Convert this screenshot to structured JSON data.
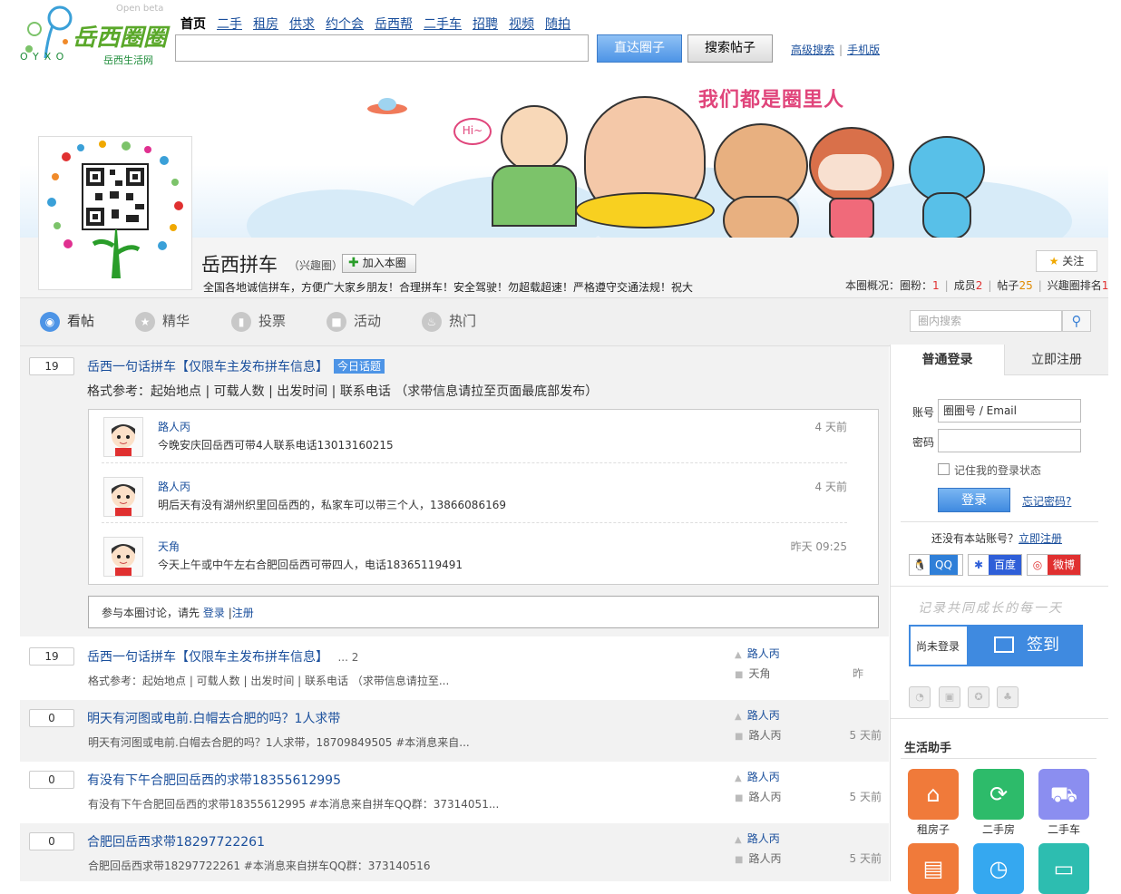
{
  "header": {
    "logo_text": "岳西圈圈",
    "logo_sub": "岳西生活网",
    "logo_letters": "OYXO",
    "beta": "Open beta",
    "nav": [
      "首页",
      "二手",
      "租房",
      "供求",
      "约个会",
      "岳西帮",
      "二手车",
      "招聘",
      "视频",
      "随拍"
    ],
    "search_placeholder": "",
    "btn_circle": "直达圈子",
    "btn_posts": "搜索帖子",
    "link_advanced": "高级搜索",
    "link_mobile": "手机版"
  },
  "banner": {
    "slogan": "我们都是圈里人",
    "hi": "Hi~"
  },
  "circle": {
    "name": "岳西拼车",
    "tag": "（兴趣圈）",
    "join": "加入本圈",
    "description": "全国各地诚信拼车，方便广大家乡朋友！合理拼车！安全驾驶！勿超载超速！严格遵守交通法规！祝大",
    "follow": "关注",
    "overview_label": "本圈概况：",
    "fans_label": "圈粉：",
    "fans": "1",
    "members_label": "成员",
    "members": "2",
    "posts_label": "帖子",
    "posts": "25",
    "rank_label": "兴趣圈排名",
    "rank": "1"
  },
  "tabs": [
    "看帖",
    "精华",
    "投票",
    "活动",
    "热门"
  ],
  "inner_search_placeholder": "圈内搜索",
  "pinned": {
    "count": "19",
    "title": "岳西一句话拼车【仅限车主发布拼车信息】",
    "badge": "今日话题",
    "format": "格式参考：起始地点 | 可载人数 | 出发时间 | 联系电话 （求带信息请拉至页面最底部发布）",
    "replies": [
      {
        "name": "路人丙",
        "text": "今晚安庆回岳西可带4人联系电话13013160215",
        "time": "4 天前"
      },
      {
        "name": "路人丙",
        "text": "明后天有没有湖州织里回岳西的，私家车可以带三个人，13866086169",
        "time": "4 天前"
      },
      {
        "name": "天角",
        "text": "今天上午或中午左右合肥回岳西可带四人，电话18365119491",
        "time": "昨天 09:25"
      }
    ],
    "join_prompt": "参与本圈讨论，请先",
    "login": "登录",
    "sep": "|",
    "register": "注册"
  },
  "topics": [
    {
      "count": "19",
      "title": "岳西一句话拼车【仅限车主发布拼车信息】",
      "pages": "... 2",
      "summary": "格式参考：起始地点 | 可载人数 | 出发时间 | 联系电话 （求带信息请拉至...",
      "author": "路人丙",
      "last": "天角",
      "ago": "昨"
    },
    {
      "count": "0",
      "title": "明天有河图或电前.白帽去合肥的吗？1人求带",
      "pages": "",
      "summary": "明天有河图或电前.白帽去合肥的吗？1人求带，18709849505 #本消息来自...",
      "author": "路人丙",
      "last": "路人丙",
      "ago": "5 天前"
    },
    {
      "count": "0",
      "title": "有没有下午合肥回岳西的求带18355612995",
      "pages": "",
      "summary": "有没有下午合肥回岳西的求带18355612995 #本消息来自拼车QQ群：37314051...",
      "author": "路人丙",
      "last": "路人丙",
      "ago": "5 天前"
    },
    {
      "count": "0",
      "title": "合肥回岳西求带18297722261",
      "pages": "",
      "summary": "合肥回岳西求带18297722261 #本消息来自拼车QQ群：373140516",
      "author": "路人丙",
      "last": "路人丙",
      "ago": "5 天前"
    }
  ],
  "login": {
    "tab_login": "普通登录",
    "tab_register": "立即注册",
    "account_label": "账号",
    "account_placeholder": "圈圈号 / Email",
    "password_label": "密码",
    "remember": "记住我的登录状态",
    "submit": "登录",
    "forgot": "忘记密码?",
    "no_account": "还没有本站账号？",
    "register_now": "立即注册",
    "social": [
      "QQ",
      "百度",
      "微博"
    ]
  },
  "sign": {
    "slogan": "记录共同成长的每一天",
    "status": "尚未登录",
    "button": "签到"
  },
  "helper": {
    "title": "生活助手",
    "apps": [
      {
        "label": "租房子",
        "color": "#f07a3a"
      },
      {
        "label": "二手房",
        "color": "#2dbb6a"
      },
      {
        "label": "二手车",
        "color": "#8b8ef0"
      },
      {
        "label": "",
        "color": "#f07a3a"
      },
      {
        "label": "",
        "color": "#35a8f0"
      },
      {
        "label": "",
        "color": "#2dbdb0"
      }
    ]
  }
}
